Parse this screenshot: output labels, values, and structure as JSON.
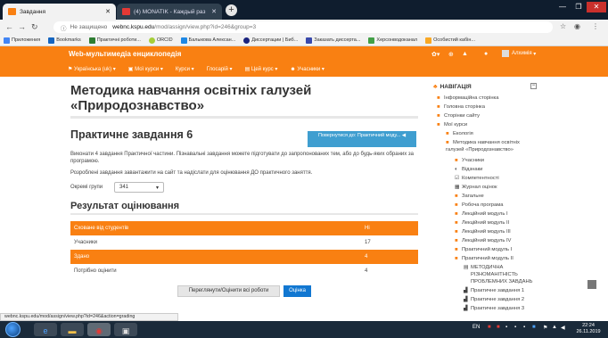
{
  "browser": {
    "tabs": [
      {
        "label": "Завдання",
        "active": true
      },
      {
        "label": "(4) MONATIK - Каждый раз",
        "active": false
      }
    ],
    "new_tab": "+",
    "win_controls": [
      "—",
      "❐",
      "✕"
    ],
    "url_security": "Не защищено",
    "url_domain": "webnc.kspu.edu",
    "url_path": "/mod/assign/view.php?id=246&group=3",
    "bookmarks": [
      {
        "label": "Приложения",
        "color": "#4285f4"
      },
      {
        "label": "Bookmarks",
        "color": "#1565c0"
      },
      {
        "label": "Практичні роботи...",
        "color": "#2e7d32"
      },
      {
        "label": "ORCID",
        "color": "#a6ce39"
      },
      {
        "label": "Балыкова Алексан...",
        "color": "#1e88e5"
      },
      {
        "label": "Диссертации | Биб...",
        "color": "#1a237e"
      },
      {
        "label": "Заказать диссерта...",
        "color": "#3949ab"
      },
      {
        "label": "Херсонводоканал",
        "color": "#43a047"
      },
      {
        "label": "Особистий кабін...",
        "color": "#f9a825"
      }
    ]
  },
  "site": {
    "title": "Web-мультимедіа енциклопедія",
    "nav": [
      "Українська (uk)",
      "Мої курси",
      "Курси",
      "Глосарій",
      "Цей курс",
      "Учасники"
    ],
    "user": "Алхимія"
  },
  "main": {
    "course_title": "Методика навчання освітніх галузей «Природознавство»",
    "assignment_title": "Практичне завдання 6",
    "back_button": "Повернутися до: Практичний моду... ◀",
    "desc1": "Виконати 4 завдання Практичної частини. Пізнавальні завдання можете підготувати до запропонованих тем, або до будь-яких обраних за програмою.",
    "desc2": "Розроблені завдання завантажити на сайт та надіслати для оцінювання ДО практичного заняття.",
    "group_label": "Окремі групи",
    "group_value": "341",
    "results_title": "Результат оцінювання",
    "table": [
      {
        "label": "Сховане від студентів",
        "value": "Ні"
      },
      {
        "label": "Учасники",
        "value": "17"
      },
      {
        "label": "Здано",
        "value": "4"
      },
      {
        "label": "Потрібно оцінити",
        "value": "4"
      }
    ],
    "btn_grade_all": "Переглянути/Оцінити всі роботи",
    "btn_grade": "Оцінка"
  },
  "navigation": {
    "header": "НАВІГАЦІЯ",
    "items": [
      "Інформаційна сторінка",
      "Головна сторінка",
      "Сторінки сайту",
      "Мої курси",
      "Екологія",
      "Методика навчання освітніх",
      "галузей «Природознавство»",
      "Учасники",
      "Відзнаки",
      "Компетентності",
      "Журнал оцінок",
      "Загальне",
      "Робоча програма",
      "Лекційний модуль I",
      "Лекційний модуль II",
      "Лекційний модуль III",
      "Лекційний модуль IV",
      "Практичний модуль I",
      "Практичний модуль II",
      "МЕТОДИЧНА",
      "РІЗНОМАНІТНІСТЬ",
      "ПРОБЛЕМНИХ ЗАВДАНЬ",
      "Практичне завдання 1",
      "Практичне завдання 2",
      "Практичне завдання 3"
    ]
  },
  "status_bar": "webnc.kspu.edu/mod/assign/view.php?id=246&action=grading",
  "taskbar": {
    "lang": "EN",
    "time": "22:24",
    "date": "26.11.2019"
  },
  "colors": {
    "brand_orange": "#f98012",
    "link_blue": "#1f6fb5",
    "button_blue": "#1177d1",
    "back_button": "#3f9ed0"
  }
}
